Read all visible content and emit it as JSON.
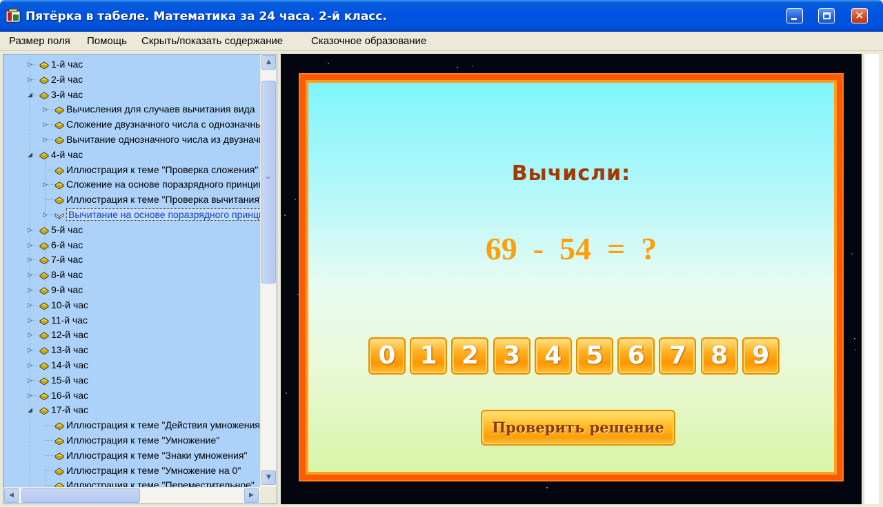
{
  "window": {
    "title": "Пятёрка в табеле. Математика за 24 часа. 2-й класс."
  },
  "menu": [
    {
      "label": "Размер поля"
    },
    {
      "label": "Помощь"
    },
    {
      "label": "Скрыть/показать содержание"
    },
    {
      "label": "Сказочное образование"
    }
  ],
  "tree": [
    {
      "label": "1-й час",
      "level": 0,
      "expander": "▷"
    },
    {
      "label": "2-й час",
      "level": 0,
      "expander": "▷"
    },
    {
      "label": "3-й час",
      "level": 0,
      "expander": "◢"
    },
    {
      "label": "Вычисления для случаев вычитания вида",
      "level": 1,
      "expander": "▷"
    },
    {
      "label": "Сложение двузначного числа с однозначным",
      "level": 1,
      "expander": "▷"
    },
    {
      "label": "Вычитание однозначного числа из двузначного",
      "level": 1,
      "expander": "▷"
    },
    {
      "label": "4-й час",
      "level": 0,
      "expander": "◢"
    },
    {
      "label": "Иллюстрация к теме \"Проверка сложения\"",
      "level": 1,
      "expander": ""
    },
    {
      "label": "Сложение на основе поразрядного принципа",
      "level": 1,
      "expander": "▷"
    },
    {
      "label": "Иллюстрация к теме \"Проверка вычитания\"",
      "level": 1,
      "expander": ""
    },
    {
      "label": "Вычитание на основе поразрядного принципа",
      "level": 1,
      "expander": "▷",
      "selected": true
    },
    {
      "label": "5-й час",
      "level": 0,
      "expander": "▷"
    },
    {
      "label": "6-й час",
      "level": 0,
      "expander": "▷"
    },
    {
      "label": "7-й час",
      "level": 0,
      "expander": "▷"
    },
    {
      "label": "8-й час",
      "level": 0,
      "expander": "▷"
    },
    {
      "label": "9-й час",
      "level": 0,
      "expander": "▷"
    },
    {
      "label": "10-й час",
      "level": 0,
      "expander": "▷"
    },
    {
      "label": "11-й час",
      "level": 0,
      "expander": "▷"
    },
    {
      "label": "12-й час",
      "level": 0,
      "expander": "▷"
    },
    {
      "label": "13-й час",
      "level": 0,
      "expander": "▷"
    },
    {
      "label": "14-й час",
      "level": 0,
      "expander": "▷"
    },
    {
      "label": "15-й час",
      "level": 0,
      "expander": "▷"
    },
    {
      "label": "16-й час",
      "level": 0,
      "expander": "▷"
    },
    {
      "label": "17-й час",
      "level": 0,
      "expander": "◢"
    },
    {
      "label": "Иллюстрация к теме \"Действия умножения\"",
      "level": 1,
      "expander": ""
    },
    {
      "label": "Иллюстрация к теме \"Умножение\"",
      "level": 1,
      "expander": ""
    },
    {
      "label": "Иллюстрация к теме \"Знаки умножения\"",
      "level": 1,
      "expander": ""
    },
    {
      "label": "Иллюстрация к теме \"Умножение на 0\"",
      "level": 1,
      "expander": ""
    },
    {
      "label": "Иллюстрация к теме \"Переместительное\"",
      "level": 1,
      "expander": ""
    }
  ],
  "game": {
    "prompt": "Вычисли:",
    "equation": "69  -  54  =  ?",
    "digits": [
      "0",
      "1",
      "2",
      "3",
      "4",
      "5",
      "6",
      "7",
      "8",
      "9"
    ],
    "check_label": "Проверить решение"
  },
  "colors": {
    "title_bar": "#0054e3",
    "tree_bg": "#acd2fa",
    "frame_orange": "#ff5a00",
    "prompt_color": "#a13a06",
    "equation_color": "#ff9d0a"
  }
}
